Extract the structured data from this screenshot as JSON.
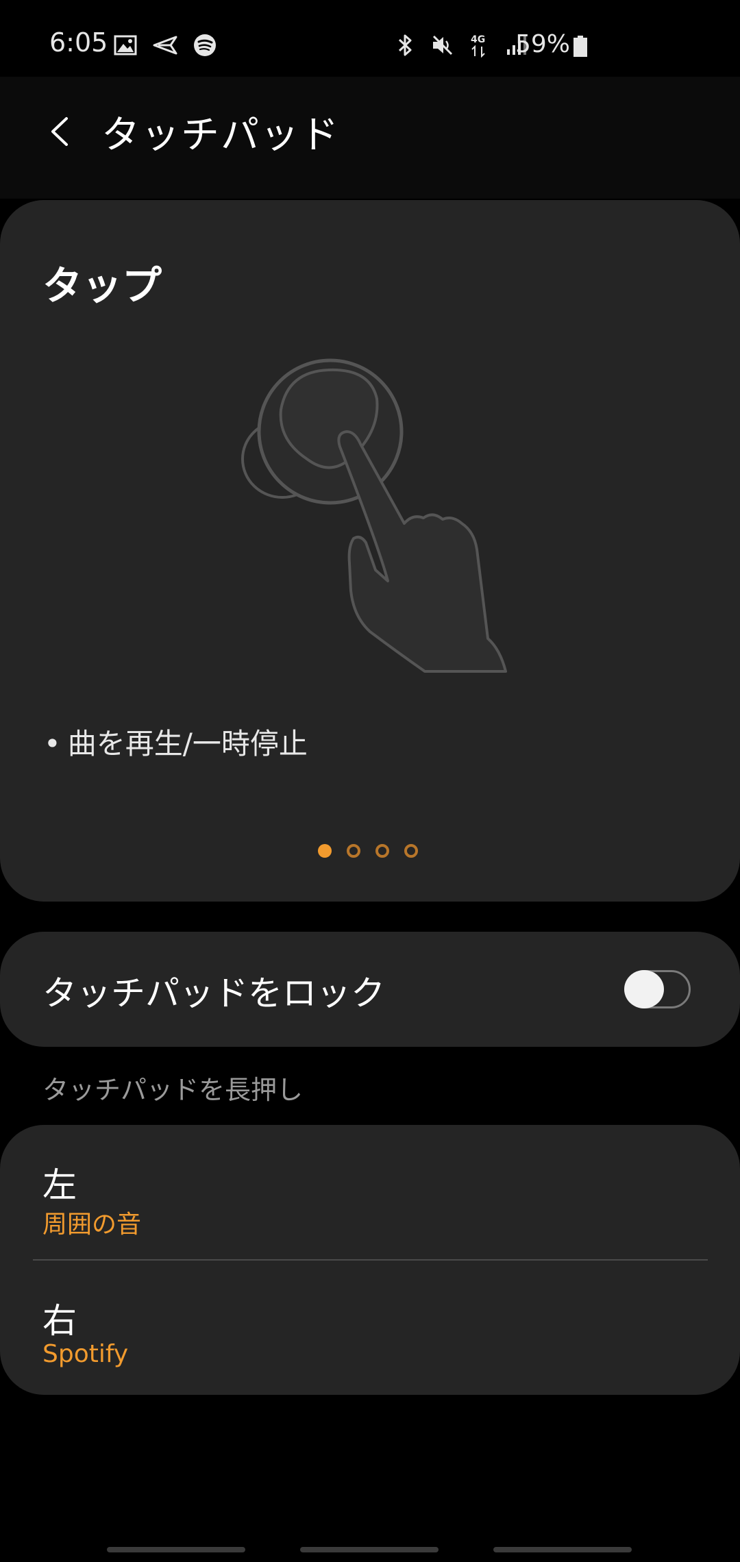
{
  "status_bar": {
    "time": "6:05",
    "left_icons": [
      "gallery-icon",
      "send-icon",
      "spotify-icon"
    ],
    "right_icons": [
      "bluetooth-icon",
      "mute-icon",
      "4g-icon",
      "signal-icon"
    ],
    "battery_percent": "59%"
  },
  "app_bar": {
    "title": "タッチパッド"
  },
  "gesture_card": {
    "title": "タップ",
    "bullet": "•",
    "description": "曲を再生/一時停止",
    "page_count": 4,
    "active_page": 1
  },
  "lock_touchpad": {
    "label": "タッチパッドをロック",
    "enabled": false
  },
  "long_press": {
    "header": "タッチパッドを長押し",
    "left": {
      "title": "左",
      "value": "周囲の音"
    },
    "right": {
      "title": "右",
      "value": "Spotify"
    }
  },
  "colors": {
    "accent": "#f29b2e",
    "card_bg": "#252525",
    "background": "#000000"
  }
}
